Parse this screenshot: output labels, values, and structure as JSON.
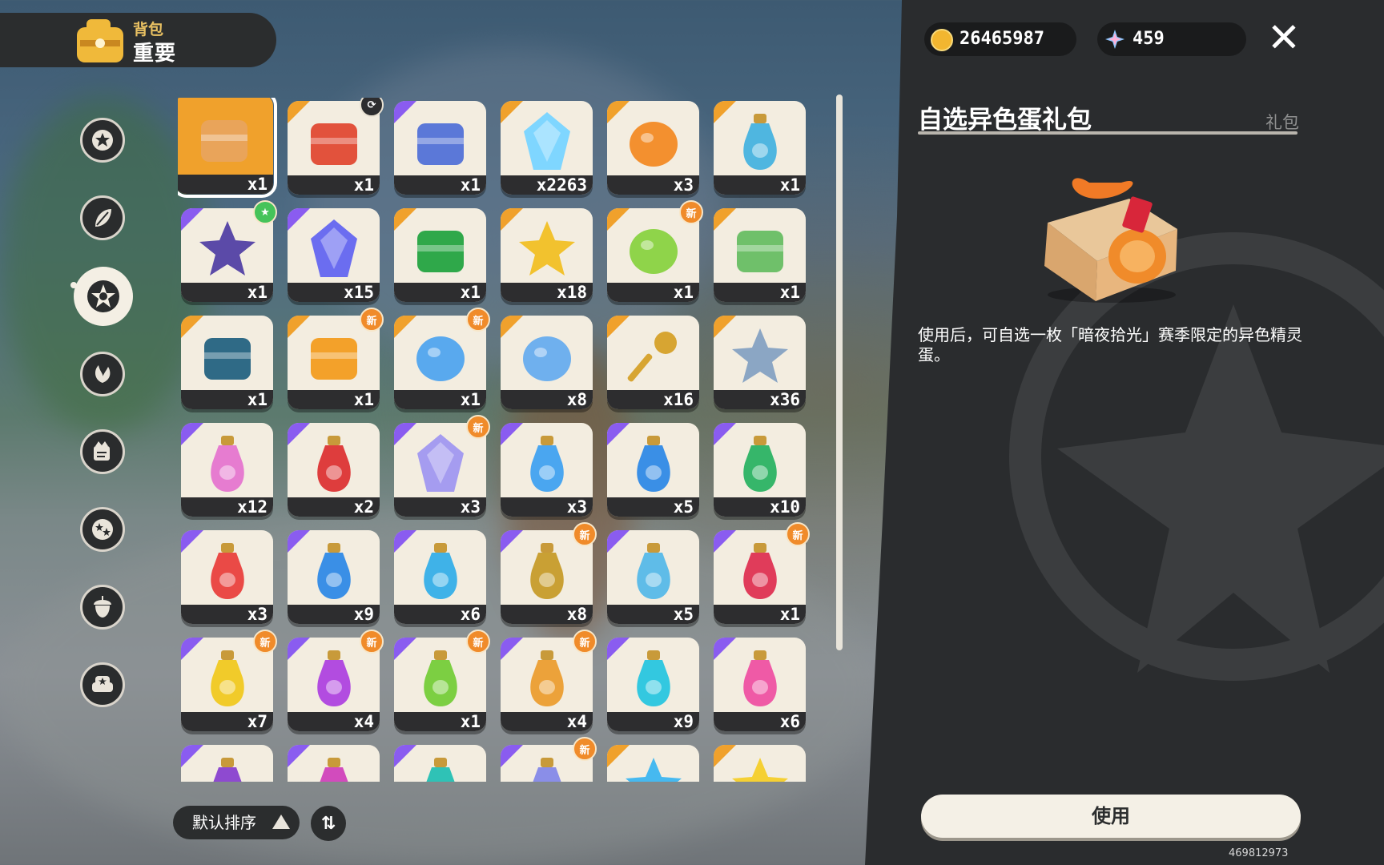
{
  "header": {
    "top_label": "背包",
    "main_label": "重要"
  },
  "sidebar": {
    "categories": [
      {
        "icon": "star-badge-icon"
      },
      {
        "icon": "leaf-icon"
      },
      {
        "icon": "sparkle-star-icon",
        "active": true
      },
      {
        "icon": "plant-icon"
      },
      {
        "icon": "crown-scroll-icon"
      },
      {
        "icon": "stars-circle-icon"
      },
      {
        "icon": "acorn-icon"
      },
      {
        "icon": "sofa-star-icon"
      }
    ]
  },
  "grid": {
    "items": [
      {
        "count": "x1",
        "rarity": "orange",
        "icon": "gift-package-icon",
        "selected": true
      },
      {
        "count": "x1",
        "rarity": "orange",
        "icon": "ticket-icon",
        "badge": "lock"
      },
      {
        "count": "x1",
        "rarity": "purple",
        "icon": "card-icon"
      },
      {
        "count": "x2263",
        "rarity": "orange",
        "icon": "crystal-prism-icon"
      },
      {
        "count": "x3",
        "rarity": "orange",
        "icon": "orange-egg-icon"
      },
      {
        "count": "x1",
        "rarity": "orange",
        "icon": "blue-bottle-icon"
      },
      {
        "count": "x1",
        "rarity": "purple",
        "icon": "star-pouch-icon",
        "badge": "star"
      },
      {
        "count": "x15",
        "rarity": "purple",
        "icon": "blue-gem-icon"
      },
      {
        "count": "x1",
        "rarity": "orange",
        "icon": "green-hat-icon"
      },
      {
        "count": "x18",
        "rarity": "orange",
        "icon": "gold-star-icon"
      },
      {
        "count": "x1",
        "rarity": "orange",
        "icon": "green-charm-icon",
        "badge": "新"
      },
      {
        "count": "x1",
        "rarity": "orange",
        "icon": "crown-leaf-icon"
      },
      {
        "count": "x1",
        "rarity": "orange",
        "icon": "feather-shell-icon"
      },
      {
        "count": "x1",
        "rarity": "orange",
        "icon": "flame-mask-icon",
        "badge": "新"
      },
      {
        "count": "x1",
        "rarity": "orange",
        "icon": "blue-charm-icon",
        "badge": "新"
      },
      {
        "count": "x8",
        "rarity": "orange",
        "icon": "blue-disk-icon"
      },
      {
        "count": "x16",
        "rarity": "orange",
        "icon": "golden-key-icon"
      },
      {
        "count": "x36",
        "rarity": "orange",
        "icon": "star-wand-icon"
      },
      {
        "count": "x12",
        "rarity": "purple",
        "icon": "rainbow-potion-icon"
      },
      {
        "count": "x2",
        "rarity": "purple",
        "icon": "red-vial-icon"
      },
      {
        "count": "x3",
        "rarity": "purple",
        "icon": "rainbow-gem-icon",
        "badge": "新"
      },
      {
        "count": "x3",
        "rarity": "purple",
        "icon": "blue-flask-icon"
      },
      {
        "count": "x5",
        "rarity": "purple",
        "icon": "blue-potion-icon"
      },
      {
        "count": "x10",
        "rarity": "purple",
        "icon": "green-potion-icon"
      },
      {
        "count": "x3",
        "rarity": "purple",
        "icon": "red-potion-icon"
      },
      {
        "count": "x9",
        "rarity": "purple",
        "icon": "blue-potion-icon"
      },
      {
        "count": "x6",
        "rarity": "purple",
        "icon": "cyan-potion-icon"
      },
      {
        "count": "x8",
        "rarity": "purple",
        "icon": "gold-potion-icon",
        "badge": "新"
      },
      {
        "count": "x5",
        "rarity": "purple",
        "icon": "skyblue-potion-icon"
      },
      {
        "count": "x1",
        "rarity": "purple",
        "icon": "crimson-potion-icon",
        "badge": "新"
      },
      {
        "count": "x7",
        "rarity": "purple",
        "icon": "yellow-potion-icon",
        "badge": "新"
      },
      {
        "count": "x4",
        "rarity": "purple",
        "icon": "violet-potion-icon",
        "badge": "新"
      },
      {
        "count": "x1",
        "rarity": "purple",
        "icon": "lime-potion-icon",
        "badge": "新"
      },
      {
        "count": "x4",
        "rarity": "purple",
        "icon": "amber-potion-icon",
        "badge": "新"
      },
      {
        "count": "x9",
        "rarity": "purple",
        "icon": "aqua-potion-icon"
      },
      {
        "count": "x6",
        "rarity": "purple",
        "icon": "pink-potion-icon"
      },
      {
        "count": "",
        "rarity": "purple",
        "icon": "purple-potion-icon"
      },
      {
        "count": "",
        "rarity": "purple",
        "icon": "magenta-potion-icon"
      },
      {
        "count": "",
        "rarity": "purple",
        "icon": "teal-potion-icon"
      },
      {
        "count": "",
        "rarity": "purple",
        "icon": "lavender-potion-icon",
        "badge": "新"
      },
      {
        "count": "",
        "rarity": "orange",
        "icon": "blue-star-icon"
      },
      {
        "count": "",
        "rarity": "orange",
        "icon": "yellow-star-icon"
      }
    ]
  },
  "sort": {
    "label": "默认排序"
  },
  "currency": {
    "coins": "26465987",
    "gems": "459"
  },
  "detail": {
    "title": "自选异色蛋礼包",
    "category": "礼包",
    "description": "使用后，可自选一枚「暗夜拾光」赛季限定的异色精灵蛋。",
    "use_label": "使用"
  },
  "uid": "469812973",
  "colors": {
    "orange_rarity": "#f0a12c",
    "purple_rarity": "#8a5cf0",
    "new_badge": "#f08b2a",
    "panel": "#2a2c2e"
  }
}
